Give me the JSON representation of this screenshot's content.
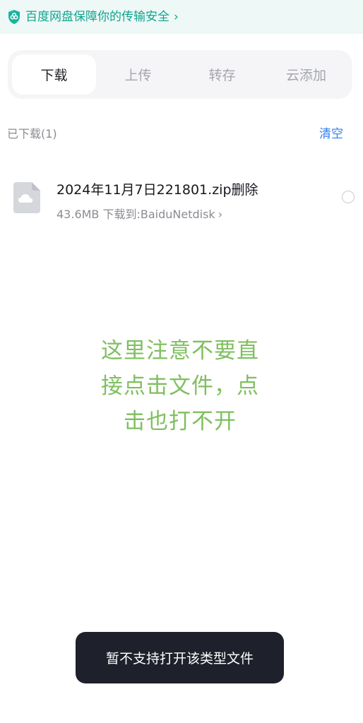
{
  "banner": {
    "text": "百度网盘保障你的传输安全",
    "chevron": "›",
    "icon": "shield-icon"
  },
  "tabs": [
    {
      "label": "下载",
      "active": true
    },
    {
      "label": "上传",
      "active": false
    },
    {
      "label": "转存",
      "active": false
    },
    {
      "label": "云添加",
      "active": false
    }
  ],
  "section": {
    "title": "已下载(1)",
    "clear_label": "清空"
  },
  "file": {
    "name": "2024年11月7日221801.zip删除",
    "meta": "43.6MB 下载到:BaiduNetdisk",
    "meta_chevron": "›",
    "icon": "cloud-file-icon"
  },
  "annotation": {
    "line1": "这里注意不要直",
    "line2": "接点击文件，点",
    "line3": "击也打不开"
  },
  "toast": {
    "text": "暂不支持打开该类型文件"
  },
  "colors": {
    "banner_bg": "#eef8f6",
    "banner_text": "#11a48f",
    "accent_blue": "#2f7ef0",
    "annotation_green": "#7fbf5f",
    "toast_bg": "#1e202b"
  }
}
